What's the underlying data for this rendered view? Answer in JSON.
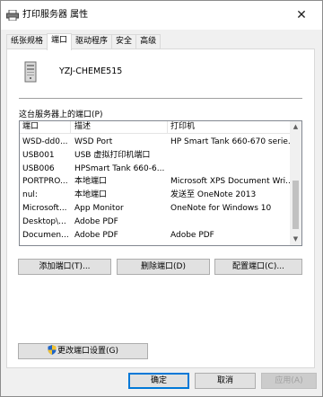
{
  "window": {
    "title": "打印服务器 属性",
    "close_label": "✕"
  },
  "tabs": [
    {
      "label": "纸张规格"
    },
    {
      "label": "端口"
    },
    {
      "label": "驱动程序"
    },
    {
      "label": "安全"
    },
    {
      "label": "高级"
    }
  ],
  "server": {
    "name": "YZJ-CHEME515"
  },
  "ports": {
    "label": "这台服务器上的端口(P)",
    "columns": [
      "端口",
      "描述",
      "打印机"
    ],
    "rows": [
      {
        "port": "WSD-dd0...",
        "description": "WSD Port",
        "printer": "HP Smart Tank 660-670 serie..."
      },
      {
        "port": "USB001",
        "description": "USB 虚拟打印机端口",
        "printer": ""
      },
      {
        "port": "USB006",
        "description": "HPSmart Tank 660-6...",
        "printer": ""
      },
      {
        "port": "PORTPRO...",
        "description": "本地端口",
        "printer": "Microsoft XPS Document Wri..."
      },
      {
        "port": "nul:",
        "description": "本地端口",
        "printer": "发送至 OneNote 2013"
      },
      {
        "port": "Microsoft...",
        "description": "App Monitor",
        "printer": "OneNote for Windows 10"
      },
      {
        "port": "Desktop\\...",
        "description": "Adobe PDF",
        "printer": ""
      },
      {
        "port": "Documen...",
        "description": "Adobe PDF",
        "printer": "Adobe PDF"
      }
    ]
  },
  "actions": {
    "add": "添加端口(T)...",
    "delete": "删除端口(D)",
    "configure": "配置端口(C)...",
    "change_settings": "更改端口设置(G)"
  },
  "footer": {
    "ok": "确定",
    "cancel": "取消",
    "apply": "应用(A)"
  },
  "colors": {
    "accent": "#0078d7",
    "panel": "#ffffff",
    "dialog_bg": "#f0f0f0"
  }
}
